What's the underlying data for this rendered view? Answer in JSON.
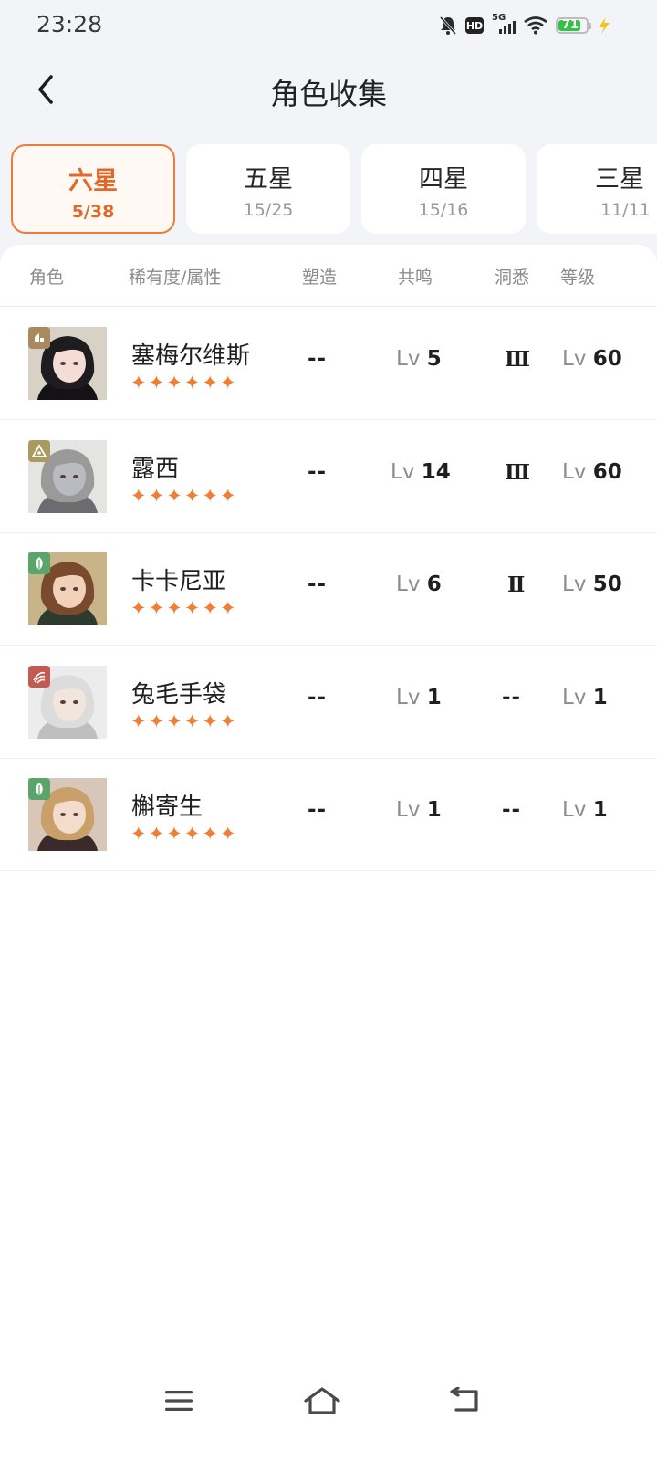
{
  "status_bar": {
    "time": "23:28",
    "network": "5G",
    "hd": "HD",
    "battery": "71",
    "icons": [
      "mute-icon",
      "hd-icon",
      "signal-icon",
      "wifi-icon",
      "battery-icon",
      "charging-icon"
    ]
  },
  "header": {
    "title": "角色收集",
    "back_icon": "chevron-left-icon"
  },
  "tabs": [
    {
      "label": "六星",
      "count": "5/38",
      "active": true
    },
    {
      "label": "五星",
      "count": "15/25",
      "active": false
    },
    {
      "label": "四星",
      "count": "15/16",
      "active": false
    },
    {
      "label": "三星",
      "count": "11/11",
      "active": false
    }
  ],
  "table": {
    "headers": {
      "character": "角色",
      "rarity": "稀有度/属性",
      "shaping": "塑造",
      "resonance": "共鸣",
      "insight": "洞悉",
      "level": "等级"
    },
    "lv_prefix": "Lv",
    "star_glyphs": "✦✦✦✦✦✦",
    "rows": [
      {
        "name": "塞梅尔维斯",
        "stars": 6,
        "shaping": "--",
        "resonance": "5",
        "insight": "Ⅲ",
        "level": "60",
        "element_color": "#a88a5c",
        "hair": "#1e1c1e",
        "skin": "#f3ddd4",
        "hat": "#141214",
        "bg": "#d8d2c6"
      },
      {
        "name": "露西",
        "stars": 6,
        "shaping": "--",
        "resonance": "14",
        "insight": "Ⅲ",
        "level": "60",
        "element_color": "#a99a60",
        "hair": "#9a9a98",
        "skin": "#b8bcc0",
        "hat": "#6a6c70",
        "bg": "#e4e4e2"
      },
      {
        "name": "卡卡尼亚",
        "stars": 6,
        "shaping": "--",
        "resonance": "6",
        "insight": "Ⅱ",
        "level": "50",
        "element_color": "#5aa56a",
        "hair": "#7a4a2e",
        "skin": "#f1d2b8",
        "hat": "#2f3a2e",
        "bg": "#c9b48a"
      },
      {
        "name": "兔毛手袋",
        "stars": 6,
        "shaping": "--",
        "resonance": "1",
        "insight": "--",
        "level": "1",
        "element_color": "#c45a52",
        "hair": "#dcdcdc",
        "skin": "#f2e6dc",
        "hat": "#bfbfbf",
        "bg": "#ececec"
      },
      {
        "name": "槲寄生",
        "stars": 6,
        "shaping": "--",
        "resonance": "1",
        "insight": "--",
        "level": "1",
        "element_color": "#5aa56a",
        "hair": "#c9a06a",
        "skin": "#f3dccc",
        "hat": "#3a2a2a",
        "bg": "#d8c7b8"
      }
    ]
  },
  "nav": {
    "menu_icon": "menu-icon",
    "home_icon": "home-icon",
    "back_icon": "back-icon"
  }
}
